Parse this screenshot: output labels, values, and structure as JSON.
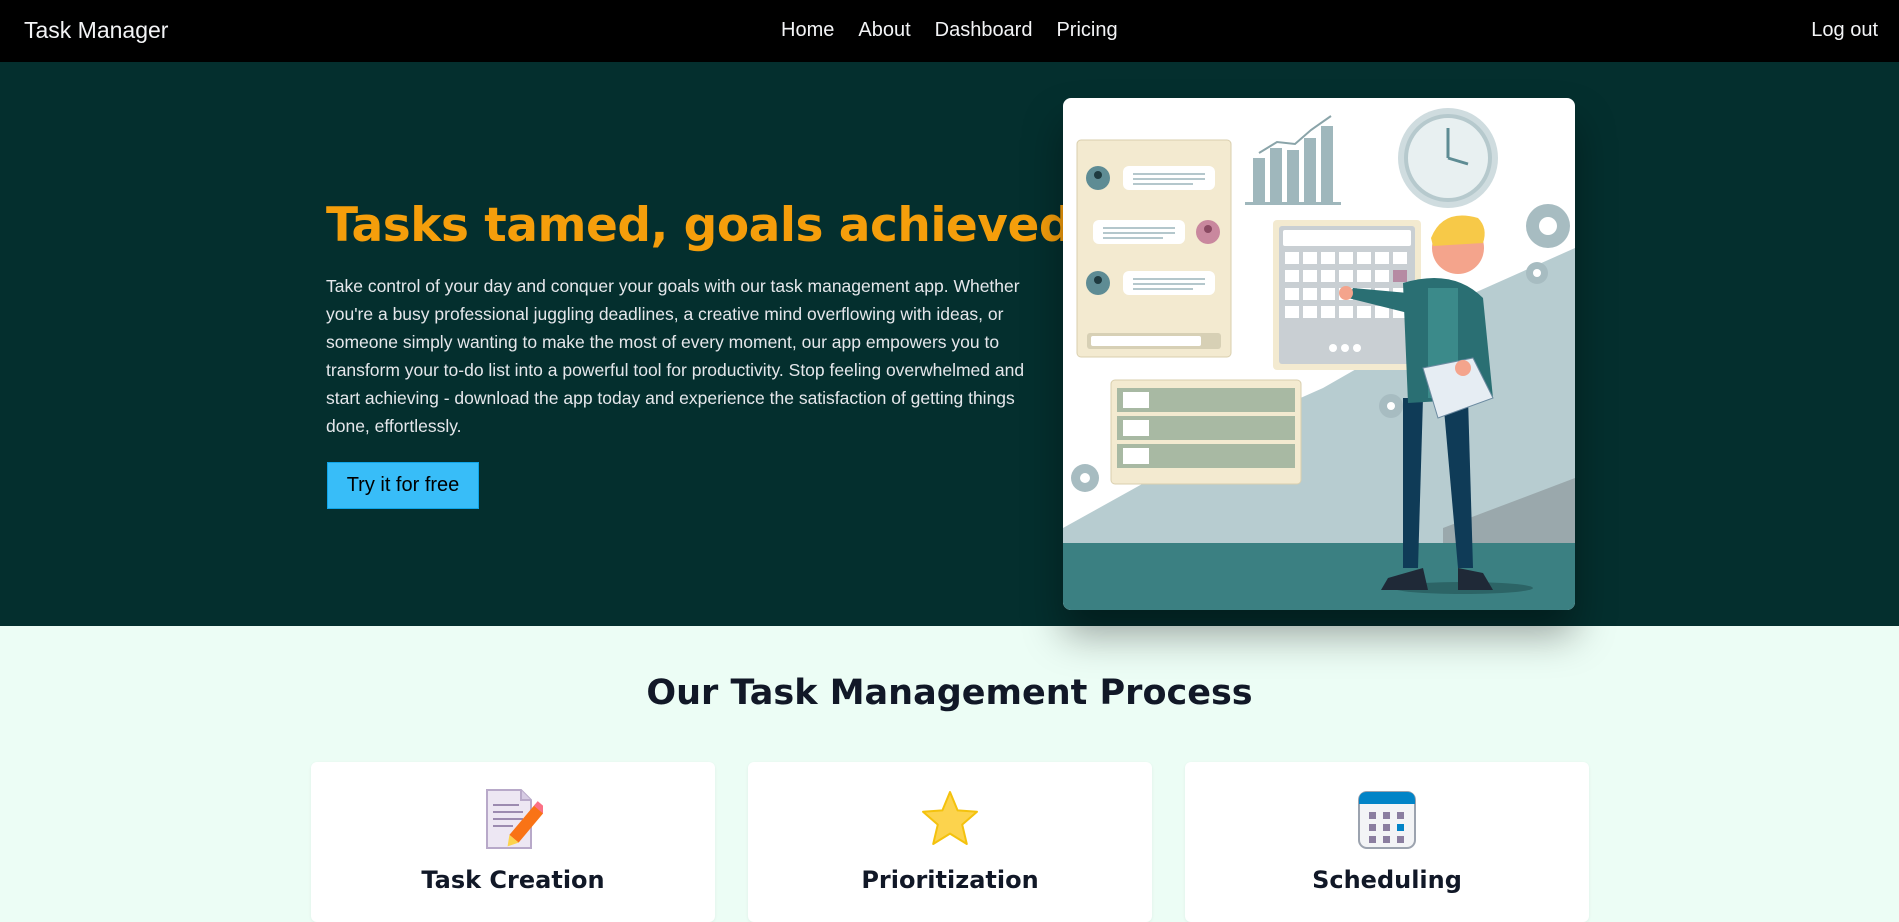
{
  "navbar": {
    "brand": "Task Manager",
    "links": [
      {
        "label": "Home"
      },
      {
        "label": "About"
      },
      {
        "label": "Dashboard"
      },
      {
        "label": "Pricing"
      }
    ],
    "logout_label": "Log out"
  },
  "hero": {
    "title": "Tasks tamed, goals achieved.",
    "text": "Take control of your day and conquer your goals with our task management app. Whether you're a busy professional juggling deadlines, a creative mind overflowing with ideas, or someone simply wanting to make the most of every moment, our app empowers you to transform your to-do list into a powerful tool for productivity. Stop feeling overwhelmed and start achieving - download the app today and experience the satisfaction of getting things done, effortlessly.",
    "cta_label": "Try it for free",
    "title_color": "#f59e0b",
    "background_color": "#042f2e",
    "cta_color": "#38bdf8"
  },
  "process": {
    "title": "Our Task Management Process",
    "cards": [
      {
        "label": "Task Creation",
        "icon": "memo-pencil-icon"
      },
      {
        "label": "Prioritization",
        "icon": "star-icon"
      },
      {
        "label": "Scheduling",
        "icon": "calendar-icon"
      }
    ]
  }
}
